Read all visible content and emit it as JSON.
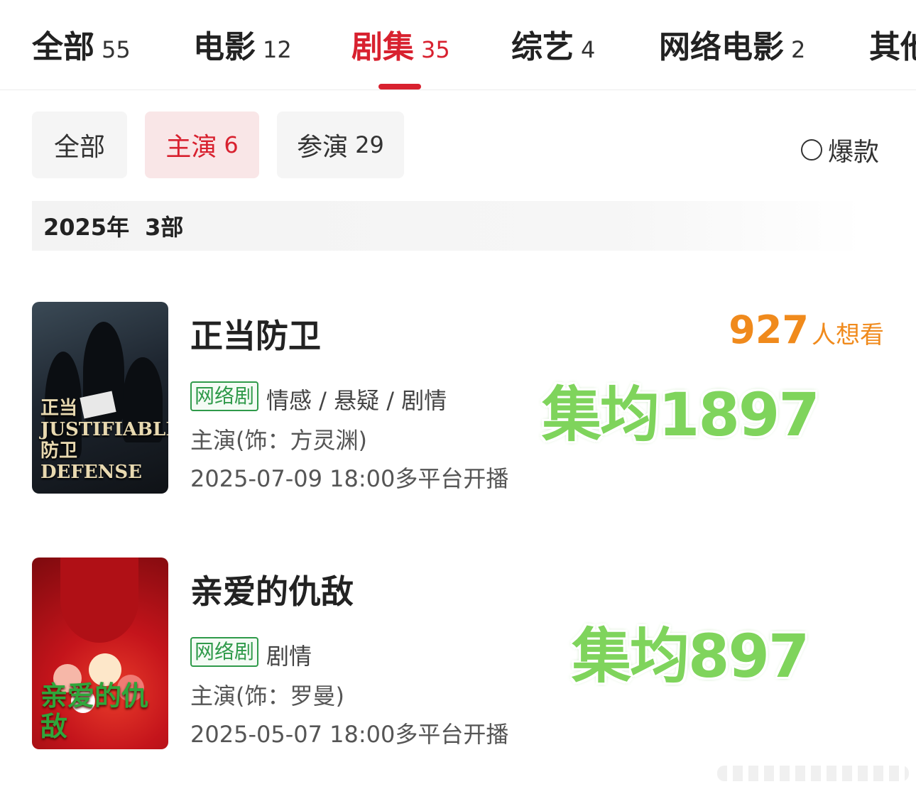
{
  "tabs": [
    {
      "label": "全部",
      "count": "55"
    },
    {
      "label": "电影",
      "count": "12"
    },
    {
      "label": "剧集",
      "count": "35"
    },
    {
      "label": "综艺",
      "count": "4"
    },
    {
      "label": "网络电影",
      "count": "2"
    },
    {
      "label": "其他",
      "count": ""
    }
  ],
  "active_tab": "剧集",
  "role_filters": [
    {
      "label": "全部",
      "count": ""
    },
    {
      "label": "主演",
      "count": "6"
    },
    {
      "label": "参演",
      "count": "29"
    }
  ],
  "active_role_filter": "主演",
  "hot_toggle": {
    "label": "爆款",
    "checked": false
  },
  "year_group": {
    "year": "2025年",
    "count": "3部"
  },
  "dramas": [
    {
      "title": "正当防卫",
      "type": "网络剧",
      "genres": "情感 / 悬疑 / 剧情",
      "role": "主演(饰：方灵渊)",
      "air": "2025-07-09 18:00多平台开播",
      "want_count": "927",
      "want_unit": "人想看",
      "overlay": "集均1897",
      "poster_text": "正当 JUSTIFIABLE\n防卫 DEFENSE"
    },
    {
      "title": "亲爱的仇敌",
      "type": "网络剧",
      "genres": "剧情",
      "role": "主演(饰：罗曼)",
      "air": "2025-05-07 18:00多平台开播",
      "overlay": "集均897",
      "poster_text": "亲爱的仇敌"
    }
  ],
  "colors": {
    "accent": "#d8212f",
    "want": "#f08a1c",
    "badge": "#2f9a4a",
    "overlay": "#7fd45c"
  }
}
